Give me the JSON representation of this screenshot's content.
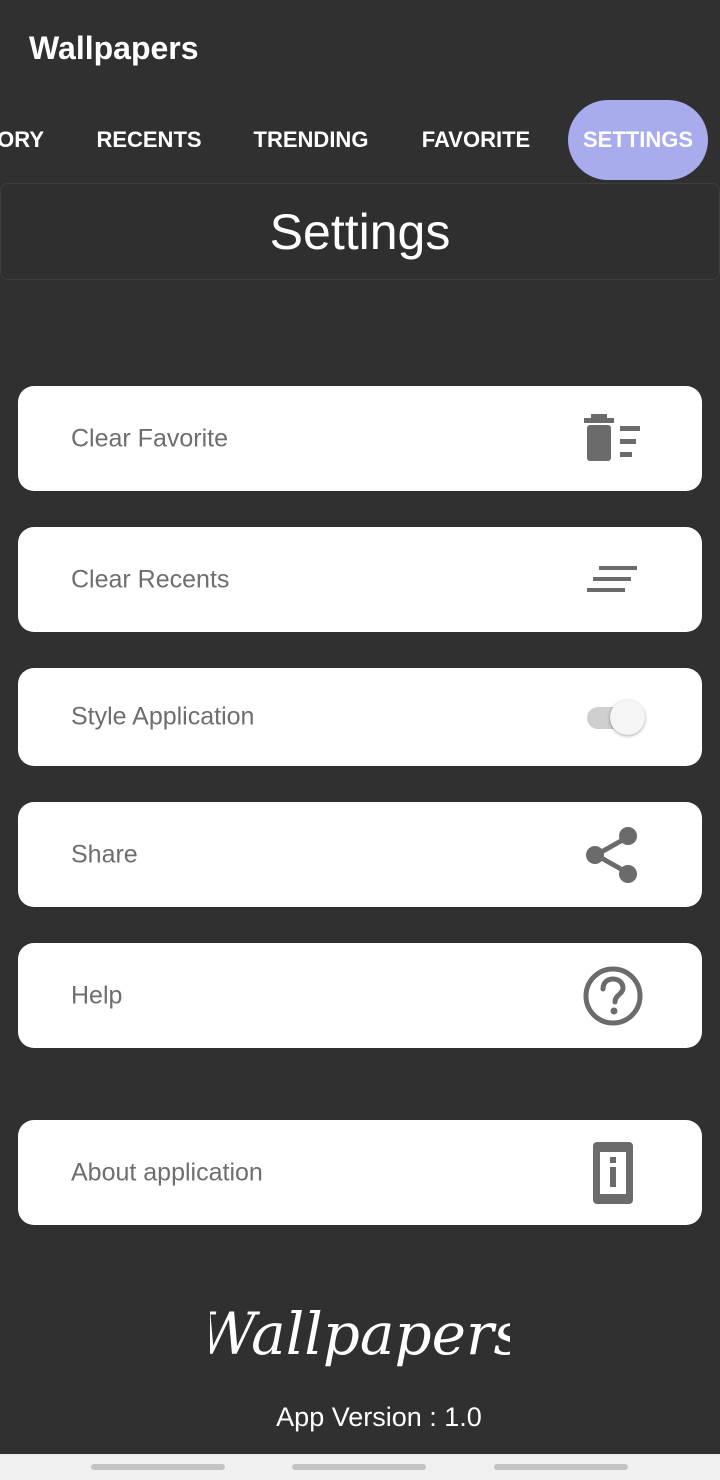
{
  "app": {
    "title": "Wallpapers"
  },
  "tabs": [
    {
      "label": "ORY",
      "active": false
    },
    {
      "label": "RECENTS",
      "active": false
    },
    {
      "label": "TRENDING",
      "active": false
    },
    {
      "label": "FAVORITE",
      "active": false
    },
    {
      "label": "SETTINGS",
      "active": true
    }
  ],
  "header": {
    "title": "Settings"
  },
  "settings": {
    "items": [
      {
        "label": "Clear Favorite",
        "icon": "delete-sweep-icon"
      },
      {
        "label": "Clear Recents",
        "icon": "clear-all-icon"
      },
      {
        "label": "Style Application",
        "icon": "toggle-switch",
        "toggle_on": true
      },
      {
        "label": "Share",
        "icon": "share-icon"
      },
      {
        "label": "Help",
        "icon": "help-circle-icon"
      },
      {
        "label": "About application",
        "icon": "info-device-icon"
      }
    ]
  },
  "footer": {
    "logo_text": "Wallpapers",
    "version": "App Version : 1.0"
  },
  "colors": {
    "background": "#303030",
    "active_tab": "#a8acec",
    "card": "#ffffff",
    "card_text": "#6e6e6e",
    "icon": "#6b6b6b"
  }
}
